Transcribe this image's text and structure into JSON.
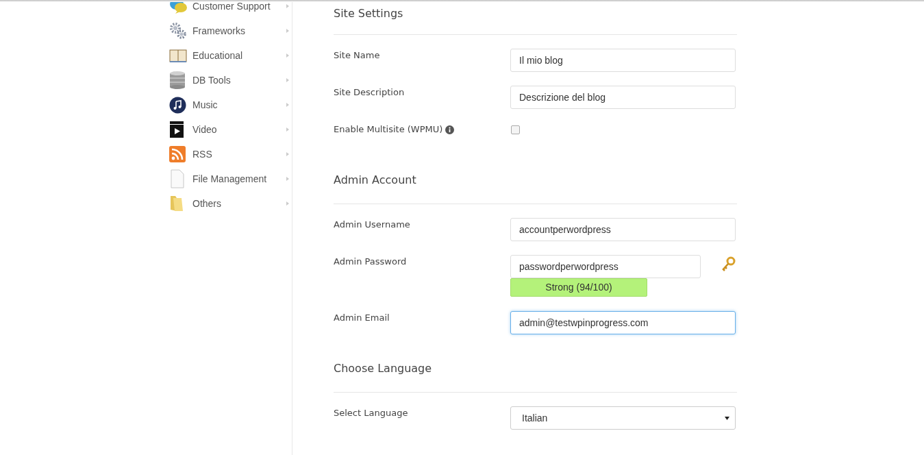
{
  "sidebar": {
    "items": [
      {
        "label": "Customer Support"
      },
      {
        "label": "Frameworks"
      },
      {
        "label": "Educational"
      },
      {
        "label": "DB Tools"
      },
      {
        "label": "Music"
      },
      {
        "label": "Video"
      },
      {
        "label": "RSS"
      },
      {
        "label": "File Management"
      },
      {
        "label": "Others"
      }
    ]
  },
  "sections": [
    {
      "title": "Site Settings",
      "fields": [
        {
          "kind": "text",
          "label": "Site Name",
          "value": "Il mio blog",
          "focused": false
        },
        {
          "kind": "text",
          "label": "Site Description",
          "value": "Descrizione del blog",
          "focused": false
        },
        {
          "kind": "checkbox",
          "label": "Enable Multisite (WPMU)",
          "checked": false
        }
      ]
    },
    {
      "title": "Admin Account",
      "fields": [
        {
          "kind": "text",
          "label": "Admin Username",
          "value": "accountperwordpress",
          "focused": false
        },
        {
          "kind": "password",
          "label": "Admin Password",
          "value": "passwordperwordpress",
          "strength": "Strong (94/100)",
          "focused": false
        },
        {
          "kind": "text",
          "label": "Admin Email",
          "value": "admin@testwpinprogress.com",
          "focused": true
        }
      ]
    },
    {
      "title": "Choose Language",
      "fields": [
        {
          "kind": "select",
          "label": "Select Language",
          "value": "Italian"
        }
      ]
    }
  ]
}
